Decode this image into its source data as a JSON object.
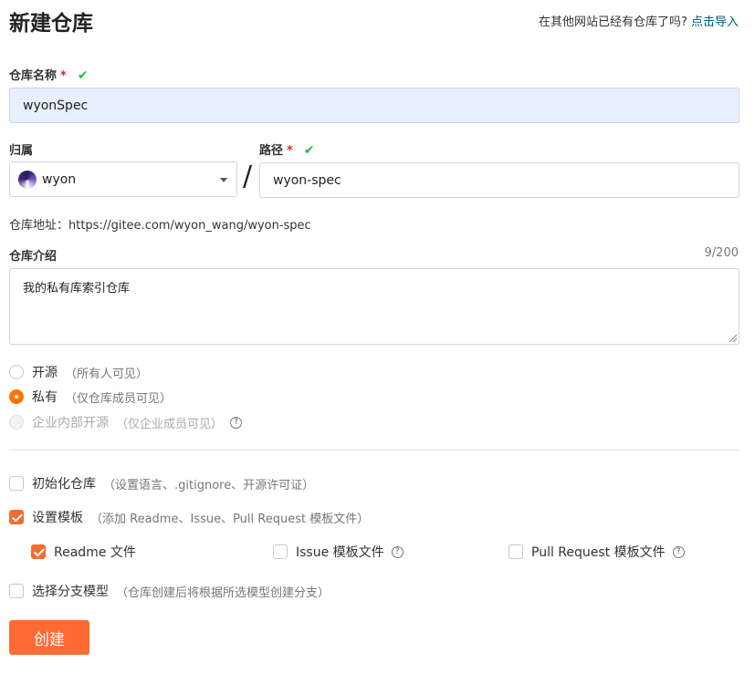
{
  "page": {
    "title": "新建仓库",
    "import_prompt": "在其他网站已经有仓库了吗?",
    "import_link": "点击导入"
  },
  "repo_name": {
    "label": "仓库名称",
    "required_mark": "*",
    "valid_mark": "✔",
    "value": "wyonSpec"
  },
  "owner": {
    "label": "归属",
    "value": "wyon",
    "separator": "/"
  },
  "path": {
    "label": "路径",
    "required_mark": "*",
    "valid_mark": "✔",
    "value": "wyon-spec"
  },
  "address": {
    "text": "仓库地址：https://gitee.com/wyon_wang/wyon-spec"
  },
  "description": {
    "label": "仓库介绍",
    "counter": "9/200",
    "value": "我的私有库索引仓库"
  },
  "visibility": {
    "options": [
      {
        "label": "开源",
        "hint": "（所有人可见）",
        "selected": false,
        "disabled": false
      },
      {
        "label": "私有",
        "hint": "（仅仓库成员可见）",
        "selected": true,
        "disabled": false
      },
      {
        "label": "企业内部开源",
        "hint": "（仅企业成员可见）",
        "selected": false,
        "disabled": true
      }
    ],
    "help_icon": "?"
  },
  "init_repo": {
    "label": "初始化仓库",
    "hint": "（设置语言、.gitignore、开源许可证）",
    "checked": false
  },
  "templates": {
    "label": "设置模板",
    "hint": "（添加 Readme、Issue、Pull Request 模板文件）",
    "checked": true,
    "items": [
      {
        "label": "Readme 文件",
        "checked": true,
        "help": ""
      },
      {
        "label": "Issue 模板文件",
        "checked": false,
        "help": "?"
      },
      {
        "label": "Pull Request 模板文件",
        "checked": false,
        "help": "?"
      }
    ]
  },
  "branch_model": {
    "label": "选择分支模型",
    "hint": "（仓库创建后将根据所选模型创建分支）",
    "checked": false
  },
  "submit": {
    "label": "创建"
  },
  "colors": {
    "accent": "#fe6b33",
    "valid": "#21ba45",
    "required": "#db2828",
    "link": "#005980",
    "autofill_bg": "#e8f0fe"
  }
}
